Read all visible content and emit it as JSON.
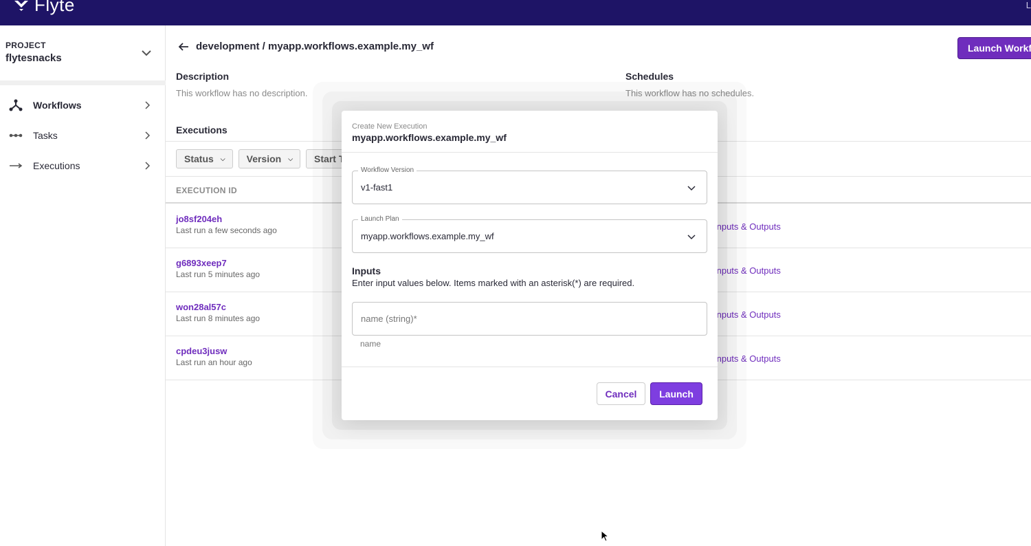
{
  "app": {
    "name": "Flyte",
    "top_right_text": "L"
  },
  "sidebar": {
    "project_label": "PROJECT",
    "project_name": "flytesnacks",
    "items": [
      {
        "label": "Workflows",
        "icon": "workflow-icon"
      },
      {
        "label": "Tasks",
        "icon": "task-icon"
      },
      {
        "label": "Executions",
        "icon": "arrow-right-icon"
      }
    ]
  },
  "header": {
    "breadcrumb": "development / myapp.workflows.example.my_wf",
    "launch_button": "Launch Workflow"
  },
  "description": {
    "title": "Description",
    "text": "This workflow has no description."
  },
  "schedules": {
    "title": "Schedules",
    "text": "This workflow has no schedules."
  },
  "executions": {
    "title": "Executions",
    "filters": [
      "Status",
      "Version",
      "Start Time"
    ],
    "column_header": "EXECUTION ID",
    "rows": [
      {
        "id": "jo8sf204eh",
        "sub": "Last run a few seconds ago",
        "io": "Inputs & Outputs"
      },
      {
        "id": "g6893xeep7",
        "sub": "Last run 5 minutes ago",
        "io": "Inputs & Outputs"
      },
      {
        "id": "won28al57c",
        "sub": "Last run 8 minutes ago",
        "io": "Inputs & Outputs"
      },
      {
        "id": "cpdeu3jusw",
        "sub": "Last run an hour ago",
        "io": "Inputs & Outputs"
      }
    ]
  },
  "dialog": {
    "subtitle": "Create New Execution",
    "title": "myapp.workflows.example.my_wf",
    "workflow_version": {
      "label": "Workflow Version",
      "value": "v1-fast1"
    },
    "launch_plan": {
      "label": "Launch Plan",
      "value": "myapp.workflows.example.my_wf"
    },
    "inputs_title": "Inputs",
    "inputs_description": "Enter input values below. Items marked with an asterisk(*) are required.",
    "name_input": {
      "placeholder": "name (string)*",
      "helper": "name"
    },
    "cancel_label": "Cancel",
    "launch_label": "Launch"
  },
  "colors": {
    "topbar": "#1e1466",
    "accent": "#6f2dbd",
    "launch_button": "#7e3ee0"
  }
}
